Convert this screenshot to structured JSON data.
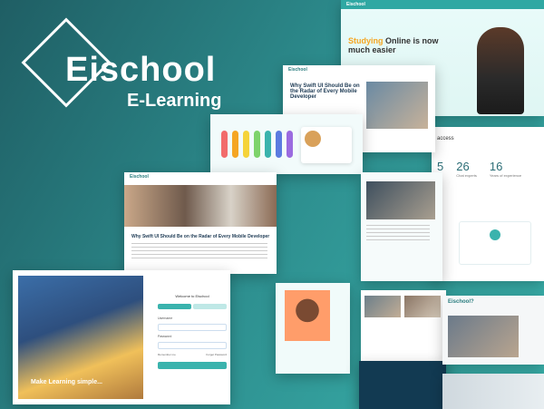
{
  "brand": {
    "title": "Eischool",
    "subtitle": "E-Learning"
  },
  "hero": {
    "logo": "Eischool",
    "headline_highlight": "Studying",
    "headline_rest": "Online is now much easier"
  },
  "stats": {
    "heading": "access",
    "items": [
      {
        "num": "5"
      },
      {
        "num": "26",
        "label": "Chat experts"
      },
      {
        "num": "16",
        "label": "Years of experience"
      }
    ]
  },
  "detail": {
    "logo": "Eischool",
    "title": "Why Swift UI Should Be on the Radar of Every Mobile Developer"
  },
  "webpage": {
    "logo": "Eischool",
    "title": "Why Swift UI Should Be on the Radar of Every Mobile Developer"
  },
  "login": {
    "tagline": "Make Learning simple...",
    "welcome": "Welcome to Eischool",
    "username_label": "Username",
    "password_label": "Password",
    "remember": "Remember me",
    "forgot": "Forget Password"
  },
  "courses": {
    "heading": "Eischool?"
  },
  "colors": {
    "accent": "#3ab3ad",
    "brand_dark": "#1f5e64",
    "highlight": "#f5a623"
  }
}
